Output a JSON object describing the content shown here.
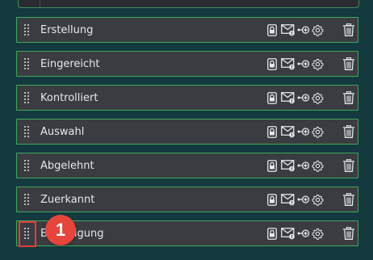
{
  "rows": [
    {
      "label": "Erstellung"
    },
    {
      "label": "Eingereicht"
    },
    {
      "label": "Kontrolliert"
    },
    {
      "label": "Auswahl"
    },
    {
      "label": "Abgelehnt"
    },
    {
      "label": "Zuerkannt"
    },
    {
      "label": "Bestätigung"
    }
  ],
  "annotation": {
    "step_number": "1"
  },
  "colors": {
    "background": "#14393f",
    "row_bg": "#3a3c42",
    "row_border": "#3fa85d",
    "highlight": "#e33b3b",
    "badge": "#e6453c"
  },
  "icons": [
    "drag-handle-icon",
    "lock-icon",
    "mail-notify-icon",
    "link-icon",
    "gear-icon",
    "trash-icon"
  ]
}
